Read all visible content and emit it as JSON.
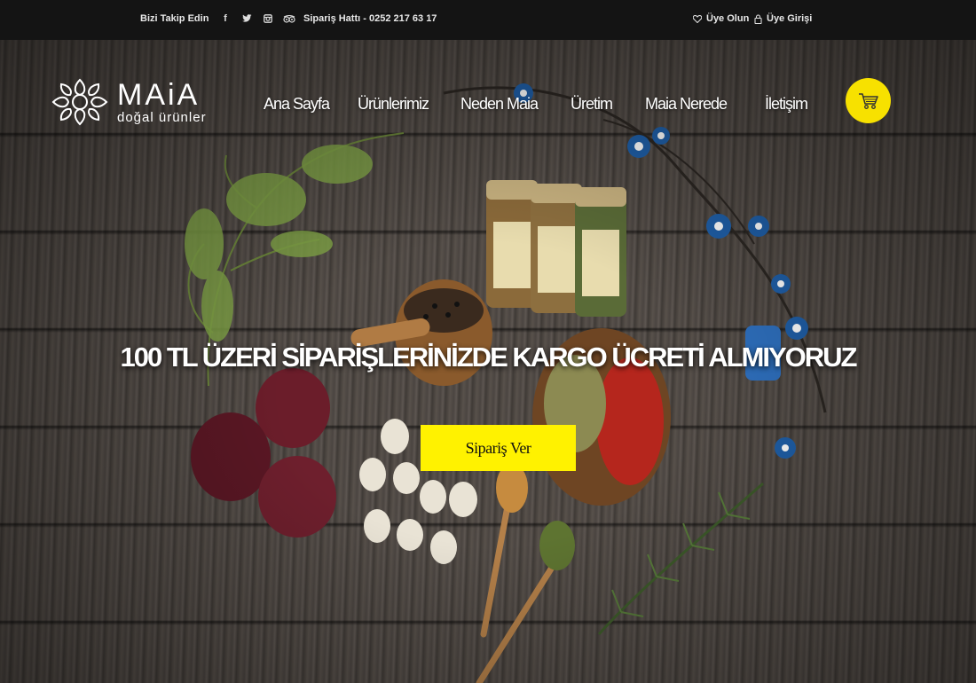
{
  "topbar": {
    "follow_label": "Bizi Takip Edin",
    "social_icons": [
      "facebook-icon",
      "twitter-icon",
      "instagram-icon",
      "tripadvisor-icon"
    ],
    "hotline": "Sipariş Hattı - 0252 217 63 17",
    "register_label": "Üye Olun",
    "login_label": "Üye Girişi"
  },
  "header": {
    "brand_name": "MAiA",
    "brand_sub": "doğal ürünler",
    "nav": [
      "Ana Sayfa",
      "Ürünlerimiz",
      "Neden Maia",
      "Üretim",
      "Maia Nerede",
      "İletişim"
    ]
  },
  "hero": {
    "headline": "100 TL ÜZERİ SİPARİŞLERİNİZDE KARGO ÜCRETİ ALMIYORUZ",
    "cta_label": "Sipariş Ver"
  },
  "colors": {
    "accent": "#f7e100",
    "topbar": "#141414",
    "wood": "#4d4743"
  }
}
